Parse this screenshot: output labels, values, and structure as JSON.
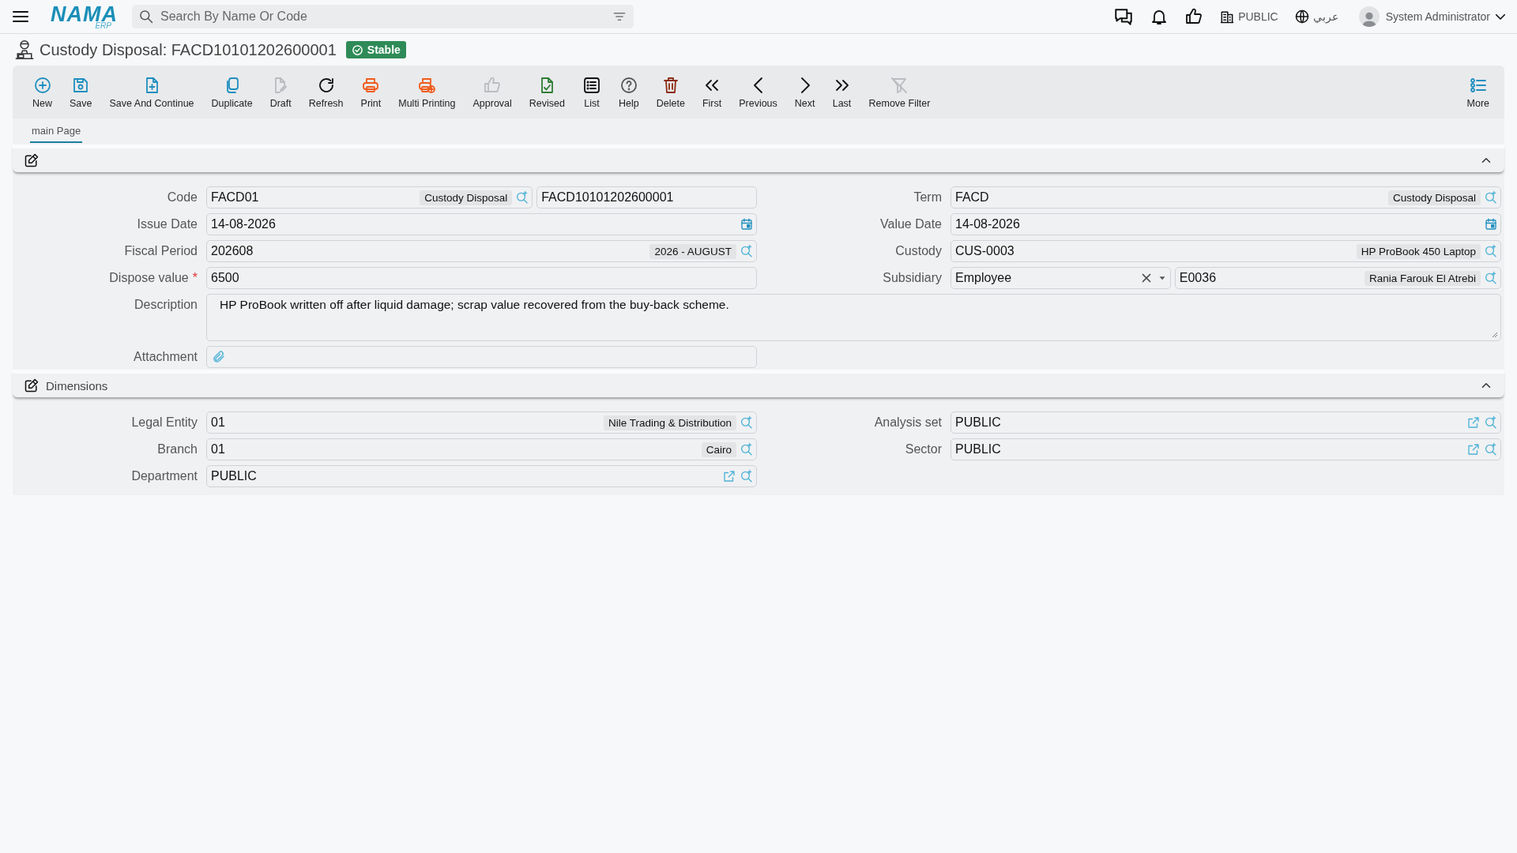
{
  "header": {
    "logo": "NAMA",
    "logo_sub": "ERP",
    "search": {
      "placeholder": "Search By Name Or Code"
    },
    "company": "PUBLIC",
    "language": "عربي",
    "user": "System Administrator"
  },
  "page": {
    "title": "Custody Disposal: FACD10101202600001",
    "status": "Stable"
  },
  "toolbar": [
    {
      "label": "New",
      "kind": "plus-circle",
      "color": "#1f8fbf",
      "disabled": false
    },
    {
      "label": "Save",
      "kind": "save",
      "color": "#1f8fbf",
      "disabled": false
    },
    {
      "label": "Save And Continue",
      "kind": "file-plus",
      "color": "#1f8fbf",
      "disabled": false
    },
    {
      "label": "Duplicate",
      "kind": "copy",
      "color": "#1f8fbf",
      "disabled": false
    },
    {
      "label": "Draft",
      "kind": "file-edit",
      "disabled": true
    },
    {
      "label": "Refresh",
      "kind": "refresh",
      "color": "#111111",
      "disabled": false
    },
    {
      "label": "Print",
      "kind": "printer",
      "color": "#f05a1a",
      "disabled": false
    },
    {
      "label": "Multi Printing",
      "kind": "printer-plus",
      "color": "#f05a1a",
      "disabled": false
    },
    {
      "label": "Approval",
      "kind": "thumb-up",
      "disabled": true
    },
    {
      "label": "Revised",
      "kind": "file-check",
      "color": "#2e7d32",
      "disabled": false
    },
    {
      "label": "List",
      "kind": "list",
      "color": "#111111",
      "disabled": false
    },
    {
      "label": "Help",
      "kind": "help",
      "color": "#555555",
      "disabled": false
    },
    {
      "label": "Delete",
      "kind": "trash",
      "color": "#8b2a10",
      "disabled": false
    },
    {
      "label": "First",
      "kind": "chevrons-left",
      "disabled": false
    },
    {
      "label": "Previous",
      "kind": "chevron-left",
      "disabled": false
    },
    {
      "label": "Next",
      "kind": "chevron-right",
      "disabled": false
    },
    {
      "label": "Last",
      "kind": "chevrons-right",
      "disabled": false
    },
    {
      "label": "Remove Filter",
      "kind": "filter-off",
      "disabled": true
    }
  ],
  "more": "More",
  "tabs": [
    {
      "label": "main Page",
      "selected": true
    }
  ],
  "sections": [
    {
      "expanded": true,
      "rows": [
        [
          {
            "label": "Code",
            "inputs": [
              {
                "kind": "lookup",
                "value": "FACD01",
                "tag": "Custody Disposal"
              },
              {
                "kind": "text",
                "value": "FACD10101202600001"
              }
            ]
          },
          {
            "label": "Term",
            "inputs": [
              {
                "kind": "lookup",
                "value": "FACD",
                "tag": "Custody Disposal"
              }
            ]
          }
        ],
        [
          {
            "label": "Issue Date",
            "inputs": [
              {
                "kind": "date",
                "value": "14-08-2026"
              }
            ]
          },
          {
            "label": "Value Date",
            "inputs": [
              {
                "kind": "date",
                "value": "14-08-2026"
              }
            ]
          }
        ],
        [
          {
            "label": "Fiscal Period",
            "inputs": [
              {
                "kind": "lookup",
                "value": "202608",
                "tag": "2026 - AUGUST"
              }
            ]
          },
          {
            "label": "Custody",
            "inputs": [
              {
                "kind": "lookup",
                "value": "CUS-0003",
                "tag": "HP ProBook 450 Laptop"
              }
            ]
          }
        ],
        [
          {
            "label": "Dispose value",
            "required_mark": "*",
            "inputs": [
              {
                "kind": "text",
                "value": "6500"
              }
            ]
          },
          {
            "label": "Subsidiary",
            "inputs": [
              {
                "kind": "select",
                "value": "Employee"
              },
              {
                "kind": "lookup",
                "value": "E0036",
                "tag": "Rania Farouk El Atrebi"
              }
            ]
          }
        ],
        [
          {
            "label": "Description",
            "wide": true,
            "inputs": [
              {
                "kind": "textarea",
                "value": "HP ProBook written off after liquid damage; scrap value recovered from the buy-back scheme."
              }
            ]
          }
        ],
        [
          {
            "label": "Attachment",
            "inputs": [
              {
                "kind": "attachment"
              }
            ]
          }
        ]
      ]
    },
    {
      "title": "Dimensions",
      "expanded": true,
      "rows": [
        [
          {
            "label": "Legal Entity",
            "inputs": [
              {
                "kind": "lookup",
                "value": "01",
                "tag": "Nile Trading & Distribution"
              }
            ]
          },
          {
            "label": "Analysis set",
            "inputs": [
              {
                "kind": "lookup",
                "value": "PUBLIC",
                "link": true
              }
            ]
          }
        ],
        [
          {
            "label": "Branch",
            "inputs": [
              {
                "kind": "lookup",
                "value": "01",
                "tag": "Cairo"
              }
            ]
          },
          {
            "label": "Sector",
            "inputs": [
              {
                "kind": "lookup",
                "value": "PUBLIC",
                "link": true
              }
            ]
          }
        ],
        [
          {
            "label": "Department",
            "inputs": [
              {
                "kind": "lookup",
                "value": "PUBLIC",
                "link": true
              }
            ]
          }
        ]
      ]
    }
  ]
}
